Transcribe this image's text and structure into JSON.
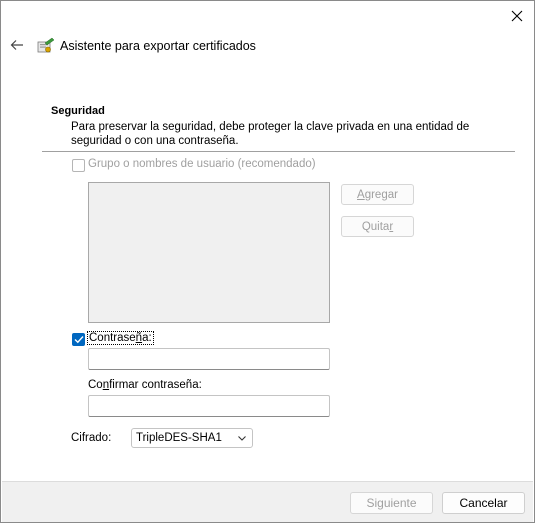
{
  "wizard": {
    "title": "Asistente para exportar certificados",
    "close_icon": "close-icon",
    "back_icon": "back-arrow-icon",
    "wizard_icon": "certificate-wizard-icon"
  },
  "security": {
    "heading": "Seguridad",
    "description": "Para preservar la seguridad, debe proteger la clave privada en una entidad de seguridad o con una contraseña.",
    "group_checkbox": {
      "label": "Grupo o nombres de usuario (recomendado)",
      "checked": false,
      "enabled": false
    },
    "add_button": {
      "pre": "",
      "ul": "A",
      "post": "gregar"
    },
    "remove_button": {
      "pre": "Quita",
      "ul": "r",
      "post": ""
    },
    "password_checkbox": {
      "pre": "Contrase",
      "ul": "ñ",
      "post": "a:",
      "checked": true
    },
    "password_value": "",
    "confirm_label": {
      "pre": "Co",
      "ul": "n",
      "post": "firmar contraseña:"
    },
    "confirm_value": "",
    "encryption_label": "Cifrado:",
    "encryption_selected": "TripleDES-SHA1"
  },
  "footer": {
    "next_label": "Siguiente",
    "cancel_label": "Cancelar"
  },
  "colors": {
    "accent": "#0067c0",
    "disabled_text": "#a0a0a0",
    "footer_bg": "#f0f0f0"
  }
}
